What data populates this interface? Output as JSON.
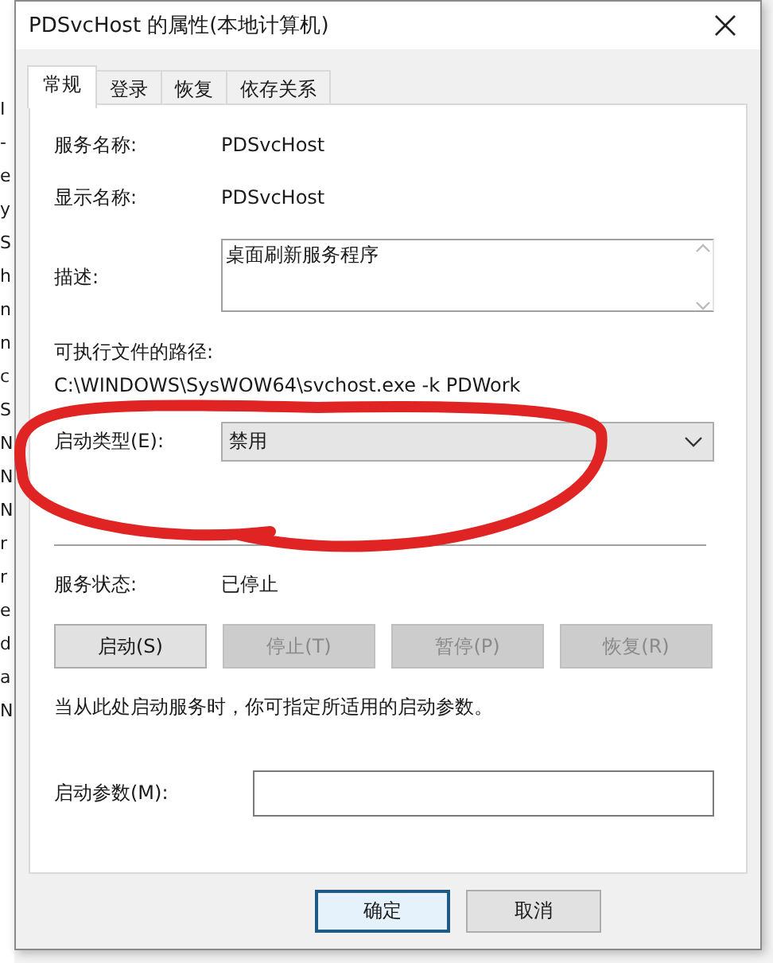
{
  "background_list": [
    "I",
    "-",
    "e",
    "y",
    "S",
    "h",
    "n",
    "n",
    "c",
    "S",
    "N",
    "N",
    "N",
    "r",
    "r",
    "e",
    "d",
    "a",
    "N"
  ],
  "window": {
    "title": "PDSvcHost 的属性(本地计算机)"
  },
  "tabs": [
    {
      "label": "常规",
      "selected": true
    },
    {
      "label": "登录",
      "selected": false
    },
    {
      "label": "恢复",
      "selected": false
    },
    {
      "label": "依存关系",
      "selected": false
    }
  ],
  "service_name": {
    "label": "服务名称:",
    "value": "PDSvcHost"
  },
  "display_name": {
    "label": "显示名称:",
    "value": "PDSvcHost"
  },
  "description": {
    "label": "描述:",
    "value": "桌面刷新服务程序"
  },
  "executable_path": {
    "label": "可执行文件的路径:",
    "value": "C:\\WINDOWS\\SysWOW64\\svchost.exe -k PDWork"
  },
  "startup_type": {
    "label": "启动类型(E):",
    "value": "禁用"
  },
  "service_status": {
    "label": "服务状态:",
    "value": "已停止"
  },
  "service_buttons": [
    {
      "label": "启动(S)",
      "disabled": false
    },
    {
      "label": "停止(T)",
      "disabled": true
    },
    {
      "label": "暂停(P)",
      "disabled": true
    },
    {
      "label": "恢复(R)",
      "disabled": true
    }
  ],
  "hint": "当从此处启动服务时，你可指定所适用的启动参数。",
  "start_parameters": {
    "label": "启动参数(M):"
  },
  "footer_buttons": [
    {
      "label": "确定",
      "default": true
    },
    {
      "label": "取消",
      "default": false
    }
  ],
  "annotation": {
    "kind": "loop",
    "color": "#e02424"
  }
}
